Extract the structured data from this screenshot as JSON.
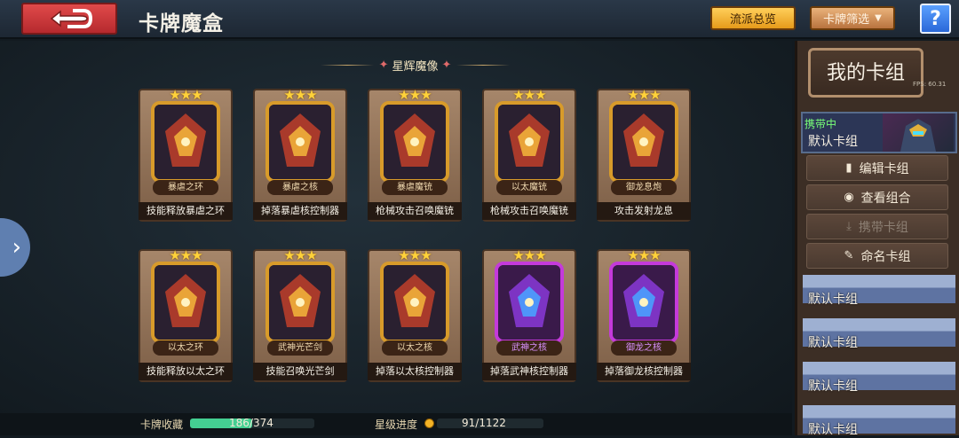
{
  "header": {
    "title": "卡牌魔盒",
    "overview_label": "流派总览",
    "filter_label": "卡牌筛选",
    "help_label": "?"
  },
  "section": {
    "title": "星辉魔像"
  },
  "cards": [
    {
      "name": "暴虐之环",
      "desc": "技能释放暴虐之环",
      "stars": 3,
      "frame": "gold"
    },
    {
      "name": "暴虐之核",
      "desc": "掉落暴虐核控制器",
      "stars": 3,
      "frame": "gold"
    },
    {
      "name": "暴虐魔铳",
      "desc": "枪械攻击召唤魔铳",
      "stars": 3,
      "frame": "gold"
    },
    {
      "name": "以太魔铳",
      "desc": "枪械攻击召唤魔铳",
      "stars": 3,
      "frame": "gold"
    },
    {
      "name": "御龙息炮",
      "desc": "攻击发射龙息",
      "stars": 3,
      "frame": "gold"
    },
    {
      "name": "以太之环",
      "desc": "技能释放以太之环",
      "stars": 3,
      "frame": "gold"
    },
    {
      "name": "武神光芒剑",
      "desc": "技能召唤光芒剑",
      "stars": 3,
      "frame": "gold"
    },
    {
      "name": "以太之核",
      "desc": "掉落以太核控制器",
      "stars": 3,
      "frame": "gold"
    },
    {
      "name": "武神之核",
      "desc": "掉落武神核控制器",
      "stars": 3,
      "frame": "purple"
    },
    {
      "name": "御龙之核",
      "desc": "掉落御龙核控制器",
      "stars": 3,
      "frame": "purple"
    }
  ],
  "stats": {
    "collection_label": "卡牌收藏",
    "collection_value": "186/374",
    "collection_fraction": 0.497,
    "star_label": "星级进度",
    "star_value": "91/1122"
  },
  "panel": {
    "title": "我的卡组",
    "fps": "FPS: 60.31",
    "carry_tag": "携带中",
    "active_deck": "默认卡组",
    "buttons": [
      {
        "label": "编辑卡组",
        "icon": "deck-icon",
        "enabled": true
      },
      {
        "label": "查看组合",
        "icon": "eye-icon",
        "enabled": true
      },
      {
        "label": "携带卡组",
        "icon": "download-icon",
        "enabled": false
      },
      {
        "label": "命名卡组",
        "icon": "pen-icon",
        "enabled": true
      }
    ],
    "decks": [
      "默认卡组",
      "默认卡组",
      "默认卡组",
      "默认卡组"
    ]
  }
}
